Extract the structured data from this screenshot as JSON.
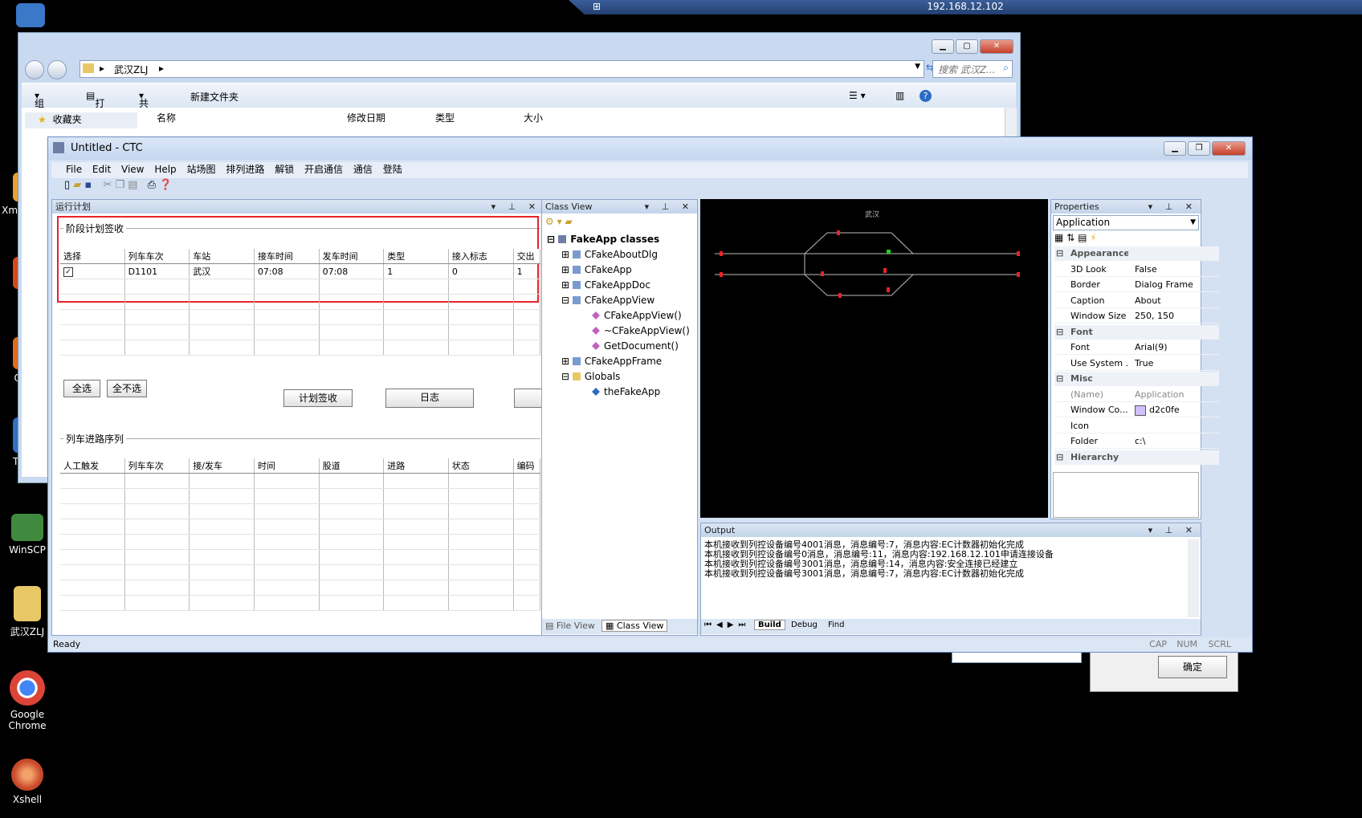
{
  "remote_bar": {
    "ip": "192.168.12.102"
  },
  "desktop_icons": [
    {
      "label": "Xm Pow",
      "color": "#e9a030"
    },
    {
      "label": "F",
      "color": "#d84a1a"
    },
    {
      "label": "Op",
      "color": "#e06d1a"
    },
    {
      "label": "Tea",
      "color": "#2f72c4"
    },
    {
      "label": "WinSCP",
      "color": "#3f8a3f"
    },
    {
      "label": "武汉ZLJ",
      "color": "#e8c766"
    },
    {
      "label": "Google Chrome",
      "color": "#db4437"
    },
    {
      "label": "Xshell",
      "color": "#c84a2a"
    }
  ],
  "explorer": {
    "path": "武汉ZLJ",
    "search_placeholder": "搜索 武汉Z...",
    "toolbar": {
      "organize": "组织",
      "open": "打开",
      "share": "共享",
      "new_folder": "新建文件夹"
    },
    "sidebar_favorites": "收藏夹",
    "columns": [
      "名称",
      "修改日期",
      "类型",
      "大小"
    ]
  },
  "ctc": {
    "title": "Untitled - CTC",
    "menu": [
      "File",
      "Edit",
      "View",
      "Help",
      "站场图",
      "排列进路",
      "解锁",
      "开启通信",
      "通信",
      "登陆"
    ],
    "plan_pane": {
      "title": "运行计划",
      "group1": "阶段计划签收",
      "columns": [
        "选择",
        "列车车次",
        "车站",
        "接车时间",
        "发车时间",
        "类型",
        "接入标志",
        "交出"
      ],
      "rows": [
        {
          "checked": true,
          "train": "D1101",
          "station": "武汉",
          "arrive": "07:08",
          "depart": "07:08",
          "type": "1",
          "flag": "0",
          "handover": "1"
        }
      ],
      "buttons": {
        "select_all": "全选",
        "select_none": "全不选",
        "sign": "计划签收",
        "log": "日志"
      },
      "group2": "列车进路序列",
      "columns2": [
        "人工触发",
        "列车车次",
        "接/发车",
        "时间",
        "股道",
        "进路",
        "状态",
        "编码"
      ]
    },
    "class_view": {
      "title": "Class View",
      "root": "FakeApp classes",
      "items": [
        "CFakeAboutDlg",
        "CFakeApp",
        "CFakeAppDoc",
        "CFakeAppView",
        "CFakeAppView()",
        "~CFakeAppView()",
        "GetDocument()",
        "CFakeAppFrame",
        "Globals",
        "theFakeApp"
      ],
      "tabs": [
        "File View",
        "Class View"
      ]
    },
    "station_label": "武汉",
    "properties": {
      "title": "Properties",
      "object": "Application",
      "rows": [
        {
          "cat": true,
          "k": "Appearance"
        },
        {
          "k": "3D Look",
          "v": "False"
        },
        {
          "k": "Border",
          "v": "Dialog Frame"
        },
        {
          "k": "Caption",
          "v": "About"
        },
        {
          "k": "Window Size",
          "v": "250, 150"
        },
        {
          "cat": true,
          "k": "Font"
        },
        {
          "k": "Font",
          "v": "Arial(9)"
        },
        {
          "k": "Use System ...",
          "v": "True"
        },
        {
          "cat": true,
          "k": "Misc"
        },
        {
          "k": "(Name)",
          "v": "Application"
        },
        {
          "k": "Window Co...",
          "v": "d2c0fe"
        },
        {
          "k": "Icon",
          "v": ""
        },
        {
          "k": "Folder",
          "v": "c:\\"
        },
        {
          "cat": true,
          "k": "Hierarchy"
        }
      ],
      "window_color": "#d2c0fe"
    },
    "output": {
      "title": "Output",
      "lines": [
        "本机接收到列控设备编号4001消息，消息编号:7，消息内容:EC计数器初始化完成",
        "本机接收到列控设备编号0消息，消息编号:11，消息内容:192.168.12.101申请连接设备",
        "本机接收到列控设备编号3001消息，消息编号:14，消息内容:安全连接已经建立",
        "本机接收到列控设备编号3001消息，消息编号:7，消息内容:EC计数器初始化完成"
      ],
      "tabs": [
        "Build",
        "Debug",
        "Find"
      ]
    },
    "status": {
      "text": "Ready",
      "indicators": [
        "CAP",
        "NUM",
        "SCRL"
      ]
    }
  },
  "dialog_behind": {
    "ok": "确定"
  }
}
